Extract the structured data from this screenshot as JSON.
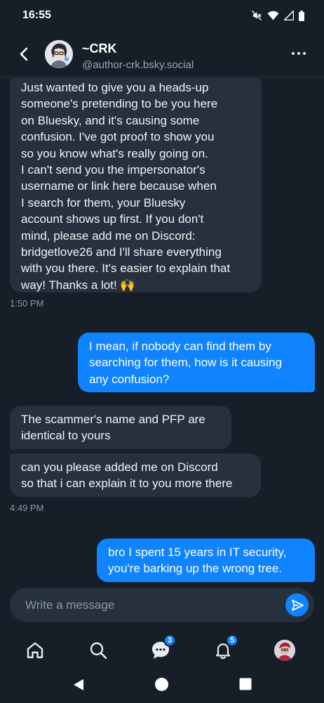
{
  "status": {
    "time": "16:55"
  },
  "header": {
    "name": "~CRK",
    "handle": "@author-crk.bsky.social"
  },
  "messages": [
    {
      "dir": "in",
      "text": "Just wanted to give you a heads-up someone's pretending to be you here on Bluesky, and it's causing some confusion. I've got proof to show you so you know what's really going on. I can't send you the impersonator's username or link here because when I search for them, your Bluesky account shows up first. If you don't mind, please add me on Discord: bridgetlove26 and I'll share everything with you there. It's easier to explain that way! Thanks a lot! 🙌"
    },
    {
      "dir": "in",
      "time": "1:50 PM"
    },
    {
      "dir": "out",
      "text": "I mean, if nobody can find them by searching for them, how is it causing any confusion?"
    },
    {
      "dir": "in",
      "text": "The scammer's name and PFP are identical to yours"
    },
    {
      "dir": "in",
      "text": "can you please added me on Discord so that i can explain it to you more there"
    },
    {
      "dir": "in",
      "time": "4:49 PM"
    },
    {
      "dir": "out",
      "text": "bro I spent 15 years in IT security, you're barking up the wrong tree."
    }
  ],
  "bubbles": {
    "m1": [
      "Just wanted to give you a heads-up",
      "someone's pretending to be you here",
      "on Bluesky, and it's causing some",
      "confusion. I've got proof to show you",
      "so you know what's really going on.",
      "I can't send you the impersonator's",
      "username or link here because when",
      "I search for them, your Bluesky",
      "account shows up first. If you don't",
      "mind, please add me on Discord:",
      "bridgetlove26 and I'll share everything",
      "with you there. It's easier to explain that",
      "way! Thanks a lot! 🙌"
    ],
    "t1": "1:50 PM",
    "m2": [
      "I mean, if nobody can find them by",
      "searching for them, how is it causing",
      "any confusion?"
    ],
    "m3": [
      "The scammer's name and PFP are",
      "identical to yours"
    ],
    "m4": [
      "can you please added me on Discord",
      "so that i can explain it to you more there"
    ],
    "t2": "4:49 PM",
    "m5": [
      "bro I spent 15 years in IT security,",
      "you're barking up the wrong tree."
    ]
  },
  "composer": {
    "placeholder": "Write a message"
  },
  "nav": {
    "chat_badge": "3",
    "notifications_badge": "5"
  },
  "colors": {
    "background": "#161e27",
    "incoming_bubble": "#26313d",
    "outgoing_bubble": "#1083fe",
    "accent": "#1083fe"
  },
  "icons": [
    "back-icon",
    "more-icon",
    "send-icon",
    "home-icon",
    "search-icon",
    "chat-icon",
    "bell-icon",
    "profile-avatar",
    "mute-icon",
    "wifi-icon",
    "signal-icon",
    "battery-icon"
  ]
}
